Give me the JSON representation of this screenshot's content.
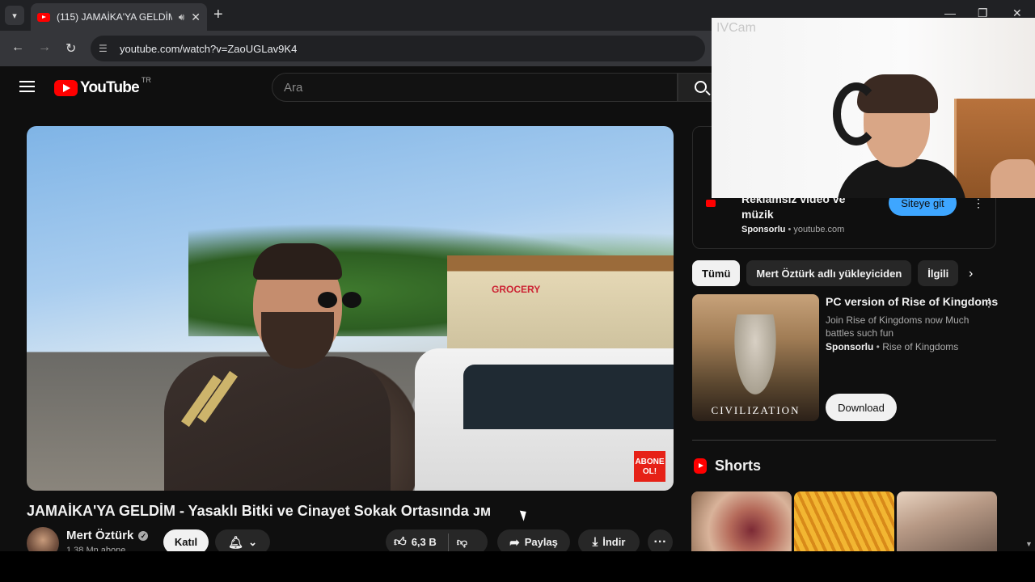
{
  "browser": {
    "tab_title": "(115) JAMAİKA'YA GELDİM",
    "new_tab": "+",
    "url": "youtube.com/watch?v=ZaoUGLav9K4"
  },
  "header": {
    "logo_text": "YouTube",
    "region": "TR",
    "search_placeholder": "Ara"
  },
  "video": {
    "title": "JAMAİKA'YA GELDİM - Yasaklı Bitki ve Cinayet Sokak Ortasında ᴊᴍ",
    "player_badge": "ABONE OL!",
    "shop_sign": "GROCERY"
  },
  "channel": {
    "name": "Mert Öztürk",
    "subscribers": "1,38 Mn abone",
    "join_label": "Katıl"
  },
  "actions": {
    "likes": "6,3 B",
    "share_label": "Paylaş",
    "download_label": "İndir",
    "more_label": "···"
  },
  "ad": {
    "title": "Reklamsız video ve müzik",
    "sponsor_label": "Sponsorlu",
    "domain": "youtube.com",
    "visit_label": "Siteye git"
  },
  "chips": [
    "Tümü",
    "Mert Öztürk adlı yükleyiciden",
    "İlgili"
  ],
  "promo": {
    "title": "PC version of Rise of Kingdoms",
    "description": "Join Rise of Kingdoms now Much battles such fun",
    "sponsor_label": "Sponsorlu",
    "advertiser": "Rise of Kingdoms",
    "thumb_caption": "CIVILIZATION",
    "download_label": "Download"
  },
  "shorts": {
    "heading": "Shorts"
  },
  "webcam": {
    "label": "IVCam"
  },
  "colors": {
    "brand_red": "#ff0000",
    "accent_blue": "#3ea6ff",
    "background": "#0f0f0f"
  }
}
